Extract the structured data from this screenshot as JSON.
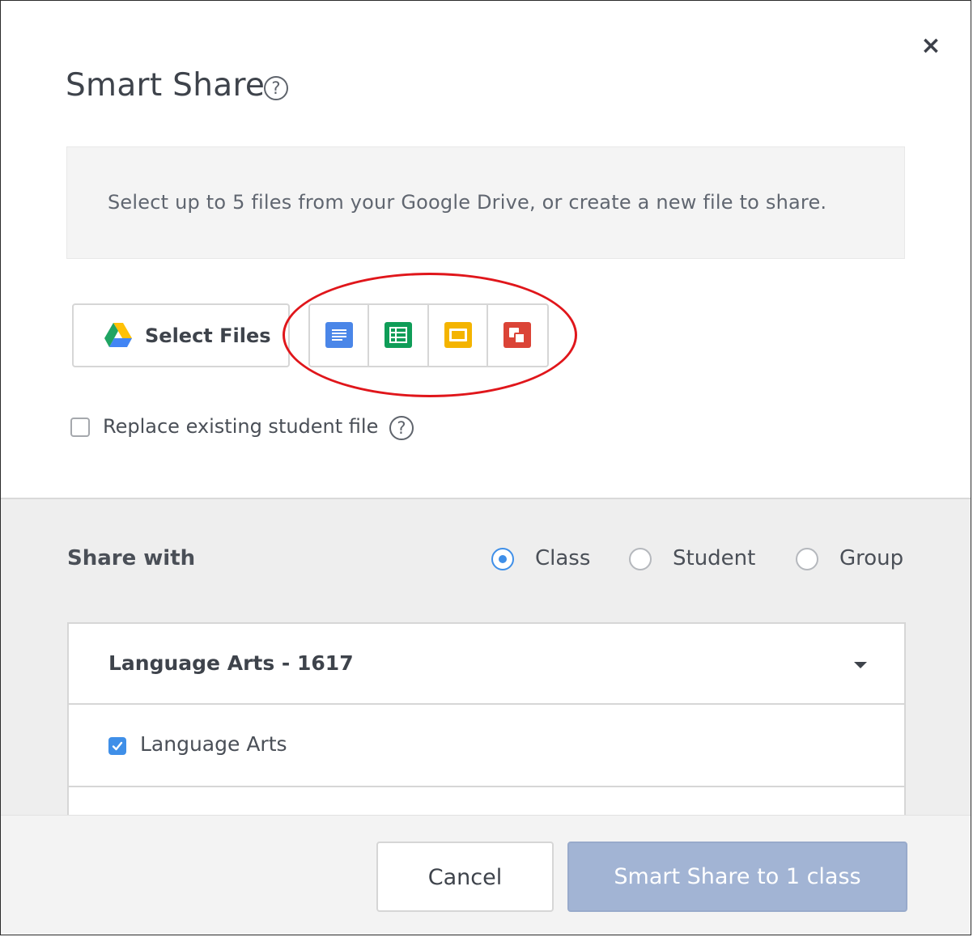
{
  "dialog": {
    "title": "Smart Share",
    "help_symbol": "?",
    "close_symbol": "×"
  },
  "info": {
    "text": "Select up to 5 files from your Google Drive, or create a new file to share."
  },
  "toolbar": {
    "select_files_label": "Select Files",
    "create_icons": [
      "google-docs-icon",
      "google-sheets-icon",
      "google-slides-icon",
      "google-drawings-icon"
    ]
  },
  "replace": {
    "label": "Replace existing student file",
    "checked": false
  },
  "share": {
    "label": "Share with",
    "options": [
      {
        "label": "Class",
        "selected": true
      },
      {
        "label": "Student",
        "selected": false
      },
      {
        "label": "Group",
        "selected": false
      }
    ]
  },
  "class_list": {
    "header": "Language Arts - 1617",
    "items": [
      {
        "label": "Language Arts",
        "checked": true
      }
    ]
  },
  "footer": {
    "cancel_label": "Cancel",
    "submit_label": "Smart Share to 1 class"
  },
  "colors": {
    "accent": "#3f8fe8",
    "annotation": "#e0161b",
    "submit_disabled": "#a2b4d4"
  }
}
